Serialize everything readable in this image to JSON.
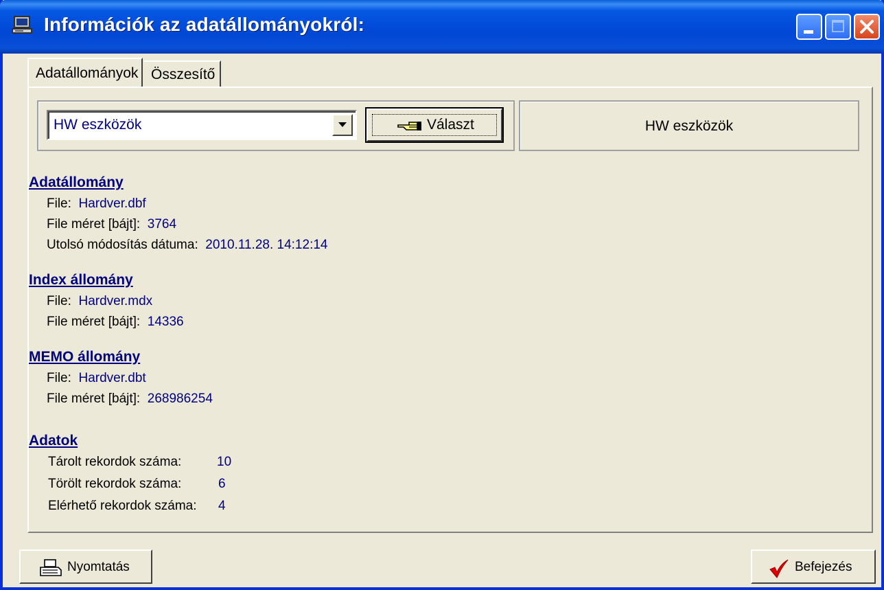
{
  "window": {
    "title": "Információk az adatállományokról:"
  },
  "tabs": [
    {
      "label": "Adatállományok"
    },
    {
      "label": "Összesítő"
    }
  ],
  "selector": {
    "selected": "HW eszközök",
    "button_label": "Választ",
    "current_label": "HW eszközök"
  },
  "data_file": {
    "heading": "Adatállomány",
    "file_label": "File:",
    "file_value": "Hardver.dbf",
    "size_label": "File méret [bájt]:",
    "size_value": "3764",
    "modified_label": "Utolsó módosítás dátuma:",
    "modified_value": "2010.11.28. 14:12:14"
  },
  "index_file": {
    "heading": "Index állomány",
    "file_label": "File:",
    "file_value": "Hardver.mdx",
    "size_label": "File méret [bájt]:",
    "size_value": "14336"
  },
  "memo_file": {
    "heading": "MEMO állomány",
    "file_label": "File:",
    "file_value": "Hardver.dbt",
    "size_label": "File méret [bájt]:",
    "size_value": "268986254"
  },
  "records": {
    "heading": "Adatok",
    "stored_label": "Tárolt rekordok száma:",
    "stored_value": "10",
    "deleted_label": "Törölt rekordok száma:",
    "deleted_value": "6",
    "available_label": "Elérhető rekordok száma:",
    "available_value": "4"
  },
  "footer": {
    "print_label": "Nyomtatás",
    "finish_label": "Befejezés"
  },
  "colors": {
    "titlebar": "#0047d6",
    "value_text": "#000080",
    "face": "#ece9d8"
  },
  "icons": [
    "computer-icon",
    "hand-pointer-icon",
    "printer-icon",
    "checkmark-icon",
    "dropdown-arrow-icon"
  ]
}
